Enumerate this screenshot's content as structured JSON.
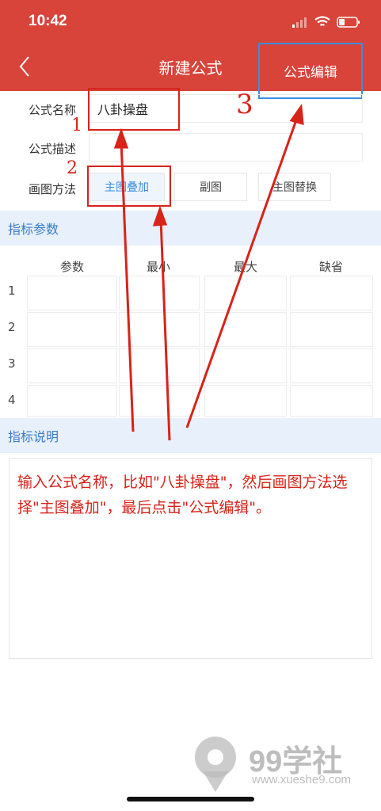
{
  "status_bar": {
    "time": "10:42"
  },
  "nav": {
    "title": "新建公式",
    "edit_button": "公式编辑"
  },
  "form": {
    "name_label": "公式名称",
    "name_value": "八卦操盘",
    "desc_label": "公式描述",
    "desc_value": "",
    "method_label": "画图方法",
    "methods": [
      "主图叠加",
      "副图",
      "主图替换"
    ],
    "selected_method": "主图叠加"
  },
  "params": {
    "section_title": "指标参数",
    "columns": [
      "参数",
      "最小",
      "最大",
      "缺省"
    ],
    "rows": [
      "1",
      "2",
      "3",
      "4"
    ]
  },
  "description": {
    "section_title": "指标说明",
    "text": "输入公式名称，比如\"八卦操盘\"，然后画图方法选择\"主图叠加\"，最后点击\"公式编辑\"。"
  },
  "annotations": {
    "step1": "1",
    "step2": "2",
    "step3": "3"
  },
  "watermark": {
    "brand": "99学社",
    "url": "www.xueshe9.com"
  },
  "colors": {
    "header": "#d8433a",
    "accent_blue": "#3a8ee0",
    "annotation_red": "#d8231a",
    "section_bg": "#e7f0fb"
  }
}
